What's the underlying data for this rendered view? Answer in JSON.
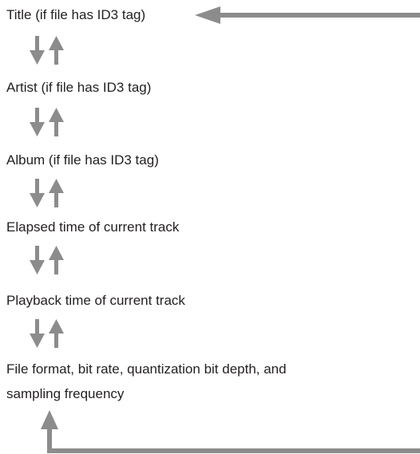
{
  "cycle": {
    "items": [
      {
        "label": "Title (if file has ID3 tag)"
      },
      {
        "label": "Artist (if file has ID3 tag)"
      },
      {
        "label": "Album (if file has ID3 tag)"
      },
      {
        "label": "Elapsed time of current track"
      },
      {
        "label": "Playback time of current track"
      },
      {
        "label_line1": "File format, bit rate, quantization bit depth, and",
        "label_line2": "sampling frequency"
      }
    ]
  },
  "colors": {
    "arrow": "#8c8c8c",
    "text": "#231f20"
  },
  "icons": {
    "step_arrows": "down-up-arrows-icon",
    "loop_arrow": "return-arrow-icon"
  }
}
